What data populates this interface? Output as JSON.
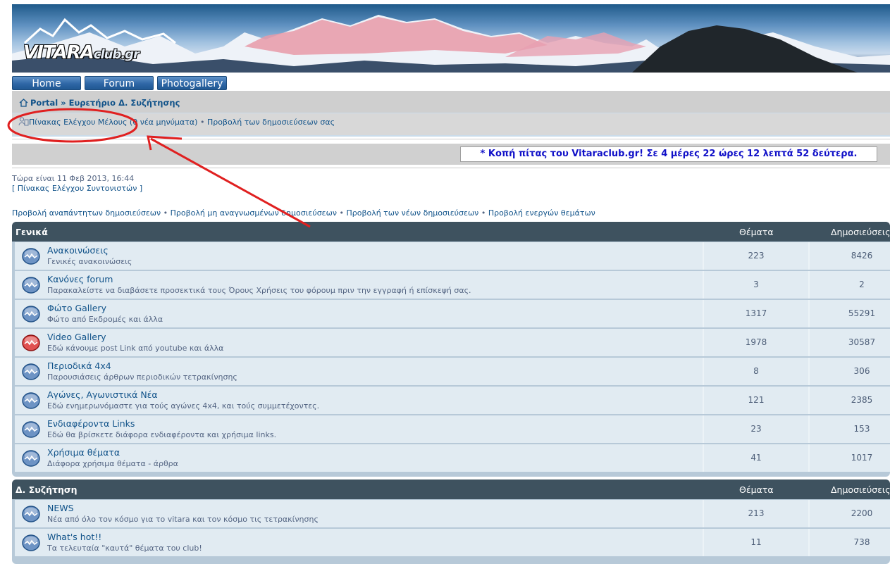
{
  "logo": {
    "main": "VITARA",
    "sub": "club.gr"
  },
  "nav": [
    {
      "label": "Home"
    },
    {
      "label": "Forum"
    },
    {
      "label": "Photogallery"
    }
  ],
  "breadcrumb": {
    "home": "Portal",
    "sep": "»",
    "current": "Ευρετήριο Δ. Συζήτησης"
  },
  "ucp": {
    "panel_label": "Πίνακας Ελέγχου Μέλους (0 νέα μηνύματα)",
    "sep": "•",
    "own_posts": "Προβολή των δημοσιεύσεων σας"
  },
  "countdown": "* Κοπή πίτας του Vitaraclub.gr! Σε 4 μέρες 22 ώρες 12 λεπτά 52 δεύτερα.",
  "now_text": "Τώρα είναι 11 Φεβ 2013, 16:44",
  "modcp": "[ Πίνακας Ελέγχου Συντονιστών ]",
  "search_links": [
    "Προβολή αναπάντητων δημοσιεύσεων",
    "Προβολή μη αναγνωσμένων δημοσιεύσεων",
    "Προβολή των νέων δημοσιεύσεων",
    "Προβολή ενεργών θεμάτων"
  ],
  "link_sep": "•",
  "categories": [
    {
      "title": "Γενικά",
      "col_topics": "Θέματα",
      "col_posts": "Δημοσιεύσεις",
      "forums": [
        {
          "name": "Ανακοινώσεις",
          "desc": "Γενικές ανακοινώσεις",
          "topics": "223",
          "posts": "8426",
          "icon": "forum-read-icon"
        },
        {
          "name": "Κανόνες forum",
          "desc": "Παρακαλείστε να διαβάσετε προσεκτικά τους Όρους Χρήσεις του φόρουμ πριν την εγγραφή ή επίσκεψή σας.",
          "topics": "3",
          "posts": "2",
          "icon": "forum-read-icon"
        },
        {
          "name": "Φώτο Gallery",
          "desc": "Φώτο από Εκδρομές και άλλα",
          "topics": "1317",
          "posts": "55291",
          "icon": "forum-read-icon"
        },
        {
          "name": "Video Gallery",
          "desc": "Εδώ κάνουμε post Link από youtube και άλλα",
          "topics": "1978",
          "posts": "30587",
          "icon": "forum-unread-icon"
        },
        {
          "name": "Περιοδικά 4x4",
          "desc": "Παρουσιάσεις άρθρων περιοδικών τετρακίνησης",
          "topics": "8",
          "posts": "306",
          "icon": "forum-read-icon"
        },
        {
          "name": "Αγώνες, Αγωνιστικά Νέα",
          "desc": "Εδώ ενημερωνόμαστε για τούς αγώνες 4x4, και τούς συμμετέχοντες.",
          "topics": "121",
          "posts": "2385",
          "icon": "forum-read-icon"
        },
        {
          "name": "Ενδιαφέροντα Links",
          "desc": "Εδώ θα βρίσκετε διάφορα ενδιαφέροντα και χρήσιμα links.",
          "topics": "23",
          "posts": "153",
          "icon": "forum-read-icon"
        },
        {
          "name": "Χρήσιμα θέματα",
          "desc": "Διάφορα χρήσιμα θέματα - άρθρα",
          "topics": "41",
          "posts": "1017",
          "icon": "forum-read-icon"
        }
      ]
    },
    {
      "title": "Δ. Συζήτηση",
      "col_topics": "Θέματα",
      "col_posts": "Δημοσιεύσεις",
      "forums": [
        {
          "name": "NEWS",
          "desc": "Νέα από όλο τον κόσμο για το vitara και τον κόσμο τις τετρακίνησης",
          "topics": "213",
          "posts": "2200",
          "icon": "forum-read-icon"
        },
        {
          "name": "What's hot!!",
          "desc": "Τα τελευταία \"καυτά\" θέματα του club!",
          "topics": "11",
          "posts": "738",
          "icon": "forum-read-icon"
        }
      ]
    }
  ],
  "colors": {
    "header_bar": "#3e525f",
    "link": "#105289",
    "annotation": "#e02020",
    "countdown": "#1010c8"
  }
}
